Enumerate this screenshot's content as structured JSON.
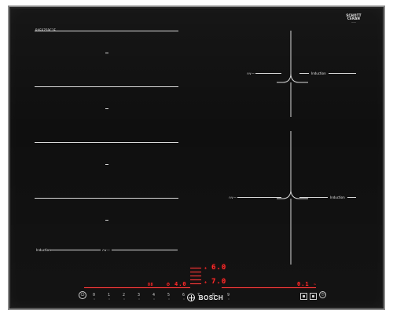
{
  "top_small_label": "PXE675DC1E",
  "brand_box": {
    "line1": "SCHOTT",
    "line2": "CERAN",
    "line3": "——"
  },
  "left_bottom_labels": {
    "induction": "Induction",
    "perfect_fry": "∩∨—"
  },
  "right_labels": {
    "top_left_icon": "∩∨—",
    "top_right": "Induction",
    "mid_left_icon": "∩∨—",
    "mid_right": "Induction"
  },
  "display": {
    "top_value": "6.0",
    "mid_value": "7.0",
    "left_value": "4.0",
    "left_digits": "88",
    "right_value": "0.1"
  },
  "slider": {
    "values": [
      "0",
      "1",
      "2",
      "3",
      "4",
      "5",
      "6",
      "7",
      "8",
      "9"
    ]
  },
  "brand": {
    "name": "BOSCH"
  },
  "colors": {
    "glass": "#0f0f0f",
    "frame": "#8a8a8a",
    "lines": "#d9d9d9",
    "red": "#ff2b2b"
  }
}
